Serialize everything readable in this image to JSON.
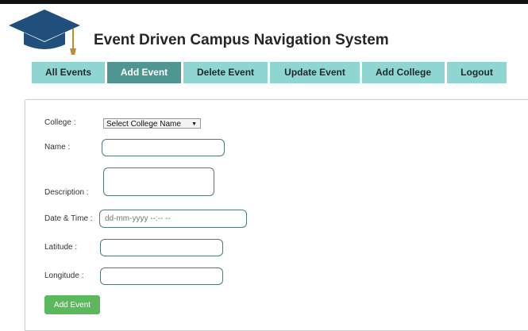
{
  "header": {
    "title": "Event Driven Campus Navigation System",
    "logo_icon": "graduation-cap-icon"
  },
  "nav": {
    "tabs": [
      {
        "label": "All Events"
      },
      {
        "label": "Add Event",
        "active": true
      },
      {
        "label": "Delete Event"
      },
      {
        "label": "Update Event"
      },
      {
        "label": "Add College"
      },
      {
        "label": "Logout"
      }
    ]
  },
  "form": {
    "college": {
      "label": "College :",
      "value": "Select College Name"
    },
    "name": {
      "label": "Name :",
      "value": ""
    },
    "description": {
      "label": "Description :",
      "value": ""
    },
    "datetime": {
      "label": "Date & Time :",
      "placeholder": "dd-mm-yyyy --:-- --"
    },
    "latitude": {
      "label": "Latitude :",
      "value": ""
    },
    "longitude": {
      "label": "Longitude :",
      "value": ""
    },
    "submit_label": "Add Event"
  },
  "colors": {
    "tab": "#8fd6d3",
    "tab_active": "#4f9591",
    "button": "#5cb85c",
    "logo": "#1f4f7a"
  }
}
